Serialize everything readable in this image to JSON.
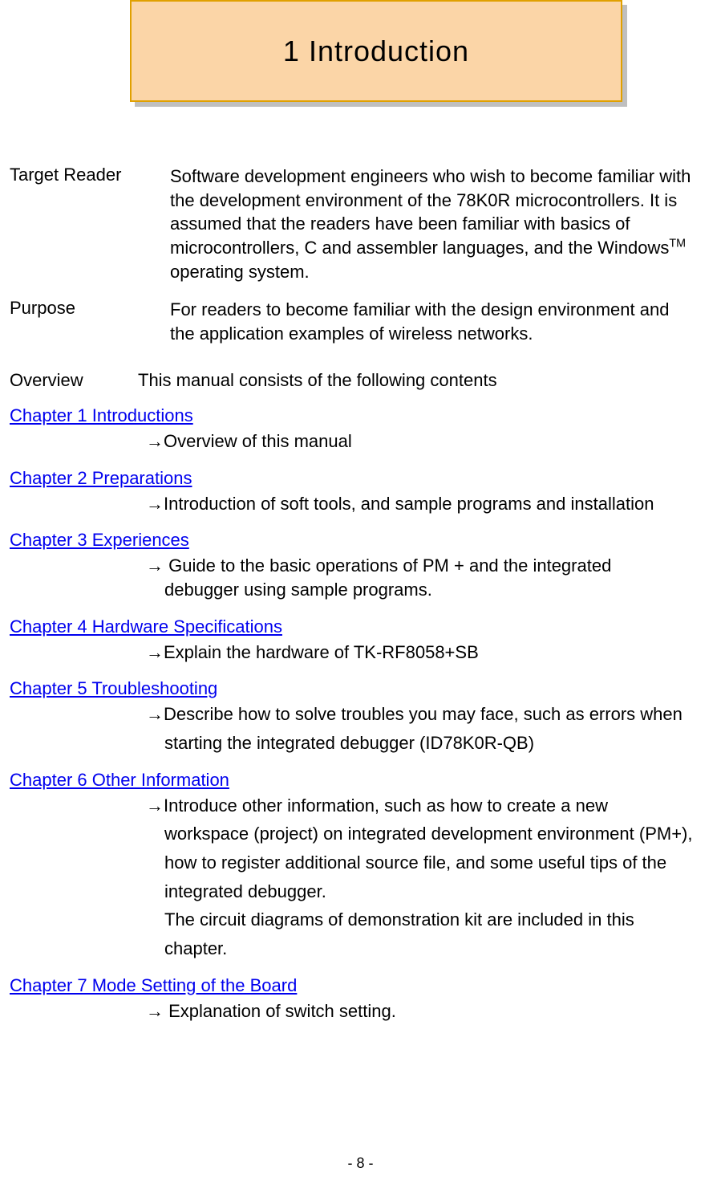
{
  "title": "1 Introduction",
  "target_reader": {
    "label": "Target Reader",
    "text_pre": "Software development engineers who wish to become familiar with the development environment of the 78K0R microcontrollers. It is assumed that the readers have been familiar with basics of microcontrollers, C and assembler languages, and the Windows",
    "tm": "TM",
    "text_post": " operating system."
  },
  "purpose": {
    "label": "Purpose",
    "text": "For readers to become familiar with the design environment and the application examples of wireless networks."
  },
  "overview": {
    "label": "Overview",
    "text": "This manual consists of the following contents"
  },
  "chapters": [
    {
      "link": "Chapter 1 Introductions",
      "arrow": "→",
      "desc": "Overview of this manual"
    },
    {
      "link": "Chapter 2 Preparations",
      "arrow": "→",
      "desc": "Introduction of soft tools, and sample programs and installation"
    },
    {
      "link": "Chapter 3 Experiences",
      "arrow": "→ ",
      "desc": "Guide to the basic operations of PM + and the integrated",
      "cont": "debugger using sample programs."
    },
    {
      "link": "Chapter 4 Hardware Specifications",
      "arrow": "→",
      "desc": "Explain the hardware of TK-RF8058+SB"
    },
    {
      "link": "Chapter 5 Troubleshooting",
      "arrow": "→",
      "desc": "Describe how to solve troubles you may face, such as errors when",
      "cont": "starting the integrated debugger (ID78K0R-QB)"
    },
    {
      "link": "Chapter 6 Other Information",
      "arrow": "→",
      "desc": "Introduce other information, such as how to create a new",
      "cont_lines": [
        "workspace (project) on integrated development environment (PM+),",
        "how to register additional source file, and some useful tips of the",
        "integrated debugger.",
        "The circuit diagrams of demonstration kit are included in this",
        "chapter."
      ]
    },
    {
      "link": "Chapter 7 Mode Setting of the Board",
      "arrow": "→ ",
      "desc": "Explanation of switch setting."
    }
  ],
  "page_number": "- 8 -"
}
